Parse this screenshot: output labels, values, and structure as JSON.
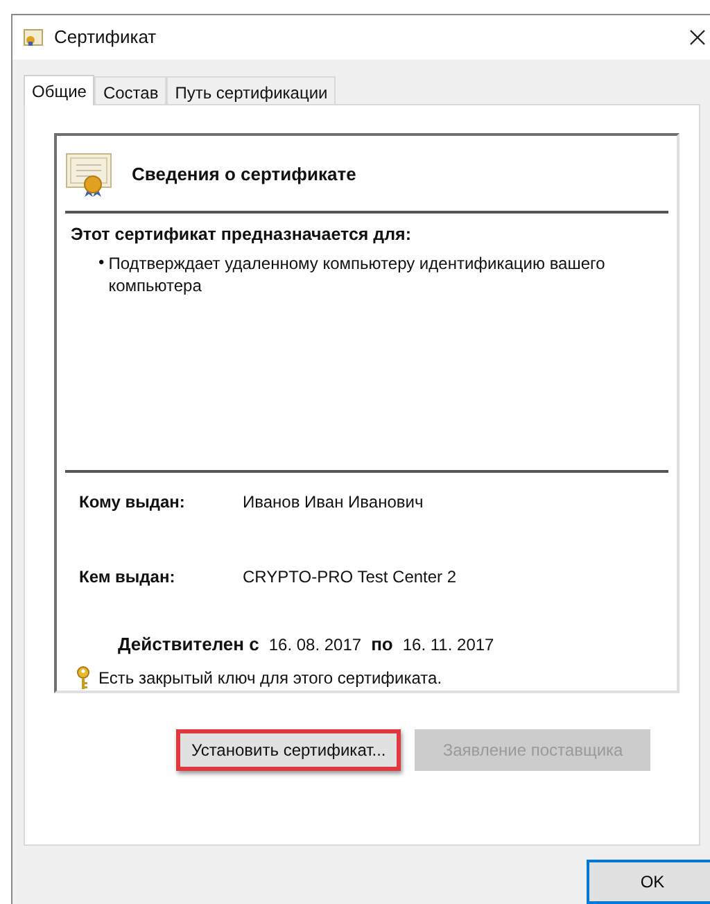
{
  "window": {
    "title": "Сертификат"
  },
  "tabs": [
    {
      "label": "Общие",
      "selected": true
    },
    {
      "label": "Состав",
      "selected": false
    },
    {
      "label": "Путь сертификации",
      "selected": false
    }
  ],
  "info": {
    "heading": "Сведения о сертификате",
    "purpose_title": "Этот сертификат предназначается для:",
    "purposes": [
      "Подтверждает удаленному компьютеру идентификацию вашего компьютера"
    ],
    "bullet": "•",
    "fields": [
      {
        "label": "Кому выдан:",
        "value": "Иванов Иван Иванович"
      },
      {
        "label": "Кем выдан:",
        "value": "CRYPTO-PRO Test Center 2"
      }
    ],
    "validity": {
      "from_label": "Действителен с",
      "from": "16. 08. 2017",
      "to_label": "по",
      "to": "16. 11. 2017"
    },
    "private_key_note": "Есть закрытый ключ для этого сертификата."
  },
  "actions": [
    {
      "label": "Установить сертификат...",
      "disabled": false,
      "highlighted": true
    },
    {
      "label": "Заявление поставщика",
      "disabled": true,
      "highlighted": false
    }
  ],
  "buttons": [
    {
      "label": "OK",
      "default": true
    }
  ]
}
